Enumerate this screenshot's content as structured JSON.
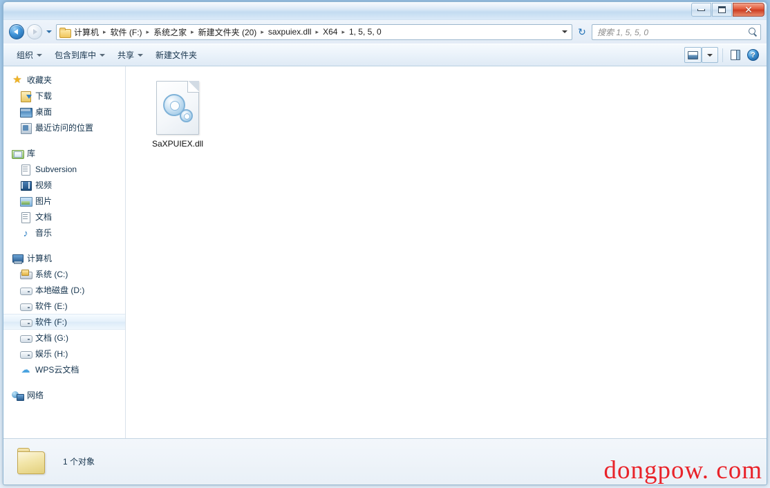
{
  "window": {
    "title": "",
    "controls": {
      "minimize": "最小化",
      "restore": "还原",
      "close": "✕"
    }
  },
  "address": {
    "back_tooltip": "后退",
    "forward_tooltip": "前进",
    "history_tooltip": "最近浏览的位置",
    "refresh_label": "↻",
    "breadcrumbs": [
      "计算机",
      "软件 (F:)",
      "系统之家",
      "新建文件夹 (20)",
      "saxpuiex.dll",
      "X64",
      "1, 5, 5, 0"
    ],
    "separator": "▸"
  },
  "search": {
    "placeholder": "搜索 1, 5, 5, 0",
    "value": ""
  },
  "toolbar": {
    "items": [
      {
        "label": "组织",
        "has_caret": true
      },
      {
        "label": "包含到库中",
        "has_caret": true
      },
      {
        "label": "共享",
        "has_caret": true
      },
      {
        "label": "新建文件夹",
        "has_caret": false
      }
    ],
    "view_button": "更改视图",
    "view_caret": "视图选项",
    "preview_pane": "显示预览窗格",
    "help": "?"
  },
  "sidebar": {
    "sections": [
      {
        "header": {
          "label": "收藏夹",
          "icon": "star-icon"
        },
        "items": [
          {
            "label": "下载",
            "icon": "downloads-icon"
          },
          {
            "label": "桌面",
            "icon": "desktop-icon"
          },
          {
            "label": "最近访问的位置",
            "icon": "recent-places-icon"
          }
        ]
      },
      {
        "header": {
          "label": "库",
          "icon": "library-icon"
        },
        "items": [
          {
            "label": "Subversion",
            "icon": "document-icon"
          },
          {
            "label": "视频",
            "icon": "video-icon"
          },
          {
            "label": "图片",
            "icon": "picture-icon"
          },
          {
            "label": "文档",
            "icon": "document-icon"
          },
          {
            "label": "音乐",
            "icon": "music-icon"
          }
        ]
      },
      {
        "header": {
          "label": "计算机",
          "icon": "computer-icon"
        },
        "items": [
          {
            "label": "系统 (C:)",
            "icon": "system-drive-icon",
            "selected": false
          },
          {
            "label": "本地磁盘 (D:)",
            "icon": "drive-icon",
            "selected": false
          },
          {
            "label": "软件 (E:)",
            "icon": "drive-icon",
            "selected": false
          },
          {
            "label": "软件 (F:)",
            "icon": "drive-icon",
            "selected": true
          },
          {
            "label": "文档 (G:)",
            "icon": "drive-icon",
            "selected": false
          },
          {
            "label": "娱乐 (H:)",
            "icon": "drive-icon",
            "selected": false
          },
          {
            "label": "WPS云文档",
            "icon": "cloud-icon",
            "selected": false
          }
        ]
      },
      {
        "header": {
          "label": "网络",
          "icon": "network-icon"
        },
        "items": []
      }
    ]
  },
  "content": {
    "files": [
      {
        "name": "SaXPUIEX.dll",
        "icon": "dll-gear-icon"
      }
    ]
  },
  "status": {
    "icon": "folder-icon",
    "text": "1 个对象"
  },
  "watermark": {
    "text": "dongpow. com",
    "color": "#e8232a"
  }
}
